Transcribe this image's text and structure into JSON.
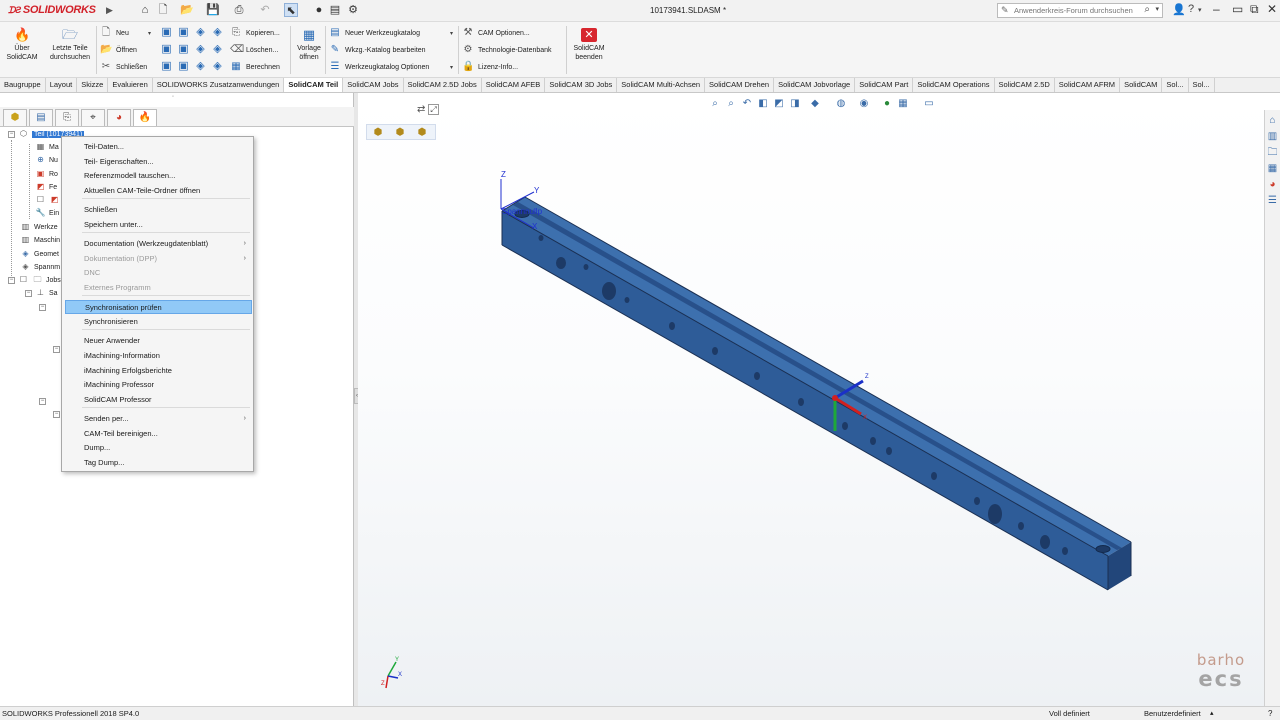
{
  "app": {
    "logo_brand": "SOLIDWORKS",
    "document_title": "10173941.SLDASM *",
    "search_placeholder": "Anwenderkreis-Forum durchsuchen"
  },
  "ribbon": {
    "uber_solidcam": "Über SolidCAM",
    "letzte_teile": "Letzte Teile durchsuchen",
    "neu": "Neu",
    "offnen": "Öffnen",
    "schliessen": "Schließen",
    "kopieren": "Kopieren...",
    "loschen": "Löschen...",
    "berechnen": "Berechnen",
    "vorlage_offnen": "Vorlage öffnen",
    "neuer_werkzeugkatalog": "Neuer Werkzeugkatalog",
    "wkzg_katalog_bearbeiten": "Wkzg.-Katalog bearbeiten",
    "werkzeugkatalog_optionen": "Werkzeugkatalog Optionen",
    "cam_optionen": "CAM Optionen...",
    "technologie_datenbank": "Technologie-Datenbank",
    "lizenz_info": "Lizenz-Info...",
    "solidcam_beenden": "SolidCAM beenden"
  },
  "tabs": [
    "Baugruppe",
    "Layout",
    "Skizze",
    "Evaluieren",
    "SOLIDWORKS Zusatzanwendungen",
    "SolidCAM Teil",
    "SolidCAM Jobs",
    "SolidCAM 2.5D Jobs",
    "SolidCAM AFEB",
    "SolidCAM 3D Jobs",
    "SolidCAM Multi-Achsen",
    "SolidCAM Drehen",
    "SolidCAM Jobvorlage",
    "SolidCAM Part",
    "SolidCAM Operations",
    "SolidCAM 2.5D",
    "SolidCAM AFRM",
    "SolidCAM",
    "Sol...",
    "Sol..."
  ],
  "active_tab": "SolidCAM Teil",
  "tree": {
    "root": "Teil (10173941)",
    "rows": [
      "Ma",
      "Nu",
      "Ro",
      "Fe",
      "",
      "Ein",
      "Werkze",
      "Maschin",
      "Geomet",
      "Spannm",
      "Jobs",
      "Sa"
    ]
  },
  "context_menu": {
    "items": [
      {
        "label": "Teil-Daten...",
        "disabled": false,
        "submenu": false
      },
      {
        "label": "Teil- Eigenschaften...",
        "disabled": false,
        "submenu": false
      },
      {
        "label": "Referenzmodell tauschen...",
        "disabled": false,
        "submenu": false
      },
      {
        "label": "Aktuellen CAM-Teile-Ordner öffnen",
        "disabled": false,
        "submenu": false
      },
      {
        "label": "Schließen",
        "disabled": false,
        "submenu": false
      },
      {
        "label": "Speichern unter...",
        "disabled": false,
        "submenu": false
      },
      {
        "label": "Documentation (Werkzeugdatenblatt)",
        "disabled": false,
        "submenu": true
      },
      {
        "label": "Dokumentation (DPP)",
        "disabled": true,
        "submenu": true
      },
      {
        "label": "DNC",
        "disabled": true,
        "submenu": false
      },
      {
        "label": "Externes Programm",
        "disabled": true,
        "submenu": false
      },
      {
        "label": "Synchronisation prüfen",
        "disabled": false,
        "submenu": false,
        "highlighted": true
      },
      {
        "label": "Synchronisieren",
        "disabled": false,
        "submenu": false
      },
      {
        "label": "Neuer Anwender",
        "disabled": false,
        "submenu": false
      },
      {
        "label": "iMachining-Information",
        "disabled": false,
        "submenu": false
      },
      {
        "label": "iMachining Erfolgsberichte",
        "disabled": false,
        "submenu": false
      },
      {
        "label": "iMachining Professor",
        "disabled": false,
        "submenu": false
      },
      {
        "label": "SolidCAM Professor",
        "disabled": false,
        "submenu": false
      },
      {
        "label": "Senden per...",
        "disabled": false,
        "submenu": true
      },
      {
        "label": "CAM-Teil bereinigen...",
        "disabled": false,
        "submenu": false
      },
      {
        "label": "Dump...",
        "disabled": false,
        "submenu": false
      },
      {
        "label": "Tag Dump...",
        "disabled": false,
        "submenu": false
      }
    ]
  },
  "viewport": {
    "axis_labels": {
      "z": "Z",
      "y": "Y",
      "x": "X"
    },
    "origin_label": "Spannnullp",
    "watermark_line1": "barho",
    "watermark_line2": "ecs",
    "colors": {
      "part": "#2f5e9a",
      "part_top": "#3a6fb0",
      "part_dark": "#213f6b",
      "x_axis": "#e02020",
      "y_axis": "#20b040",
      "z_axis": "#2030d0"
    }
  },
  "status": {
    "left": "SOLIDWORKS Professionell 2018 SP4.0",
    "state": "Voll definiert",
    "units": "Benutzerdefiniert"
  }
}
